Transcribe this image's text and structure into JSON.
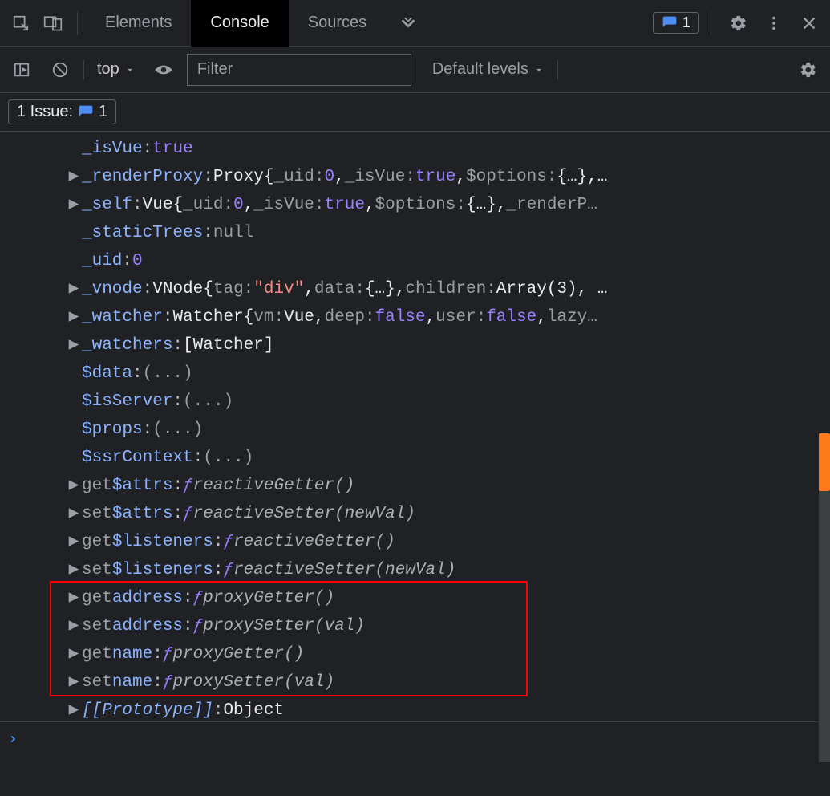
{
  "toolbar": {
    "tabs": {
      "elements": "Elements",
      "console": "Console",
      "sources": "Sources"
    },
    "issuesCount": "1"
  },
  "subtoolbar": {
    "context": "top",
    "filterPlaceholder": "Filter",
    "levels": "Default levels"
  },
  "issues": {
    "label": "1 Issue:",
    "count": "1"
  },
  "lines": {
    "isVue": {
      "k": "_isVue",
      "v": "true"
    },
    "renderProxy": {
      "k": "_renderProxy",
      "cls": "Proxy",
      "uid": "_uid",
      "uidv": "0",
      "isv": "_isVue",
      "isvv": "true",
      "opt": "$options",
      "br": "{…},"
    },
    "self": {
      "k": "_self",
      "cls": "Vue",
      "uid": "_uid",
      "uidv": "0",
      "isv": "_isVue",
      "isvv": "true",
      "opt": "$options",
      "br": "{…}",
      "rp": "_renderP…"
    },
    "staticTrees": {
      "k": "_staticTrees",
      "v": "null"
    },
    "uid": {
      "k": "_uid",
      "v": "0"
    },
    "vnode": {
      "k": "_vnode",
      "cls": "VNode",
      "tag": "tag",
      "tagv": "\"div\"",
      "data": "data",
      "br": "{…}",
      "ch": "children",
      "arr": "Array(3)"
    },
    "watcher": {
      "k": "_watcher",
      "cls": "Watcher",
      "vm": "vm",
      "vmv": "Vue",
      "deep": "deep",
      "deepv": "false",
      "user": "user",
      "userv": "false",
      "lazy": "lazy…"
    },
    "watchers": {
      "k": "_watchers",
      "v": "[Watcher]"
    },
    "data": {
      "k": "$data",
      "v": "(...)"
    },
    "isServer": {
      "k": "$isServer",
      "v": "(...)"
    },
    "props": {
      "k": "$props",
      "v": "(...)"
    },
    "ssr": {
      "k": "$ssrContext",
      "v": "(...)"
    },
    "getAttrs": {
      "pre": "get ",
      "k": "$attrs",
      "fn": "reactiveGetter()"
    },
    "setAttrs": {
      "pre": "set ",
      "k": "$attrs",
      "fn": "reactiveSetter(newVal)"
    },
    "getListeners": {
      "pre": "get ",
      "k": "$listeners",
      "fn": "reactiveGetter()"
    },
    "setListeners": {
      "pre": "set ",
      "k": "$listeners",
      "fn": "reactiveSetter(newVal)"
    },
    "getAddress": {
      "pre": "get ",
      "k": "address",
      "fn": "proxyGetter()"
    },
    "setAddress": {
      "pre": "set ",
      "k": "address",
      "fn": "proxySetter(val)"
    },
    "getName": {
      "pre": "get ",
      "k": "name",
      "fn": "proxyGetter()"
    },
    "setName": {
      "pre": "set ",
      "k": "name",
      "fn": "proxySetter(val)"
    },
    "proto": {
      "k": "[[Prototype]]",
      "v": "Object"
    }
  }
}
